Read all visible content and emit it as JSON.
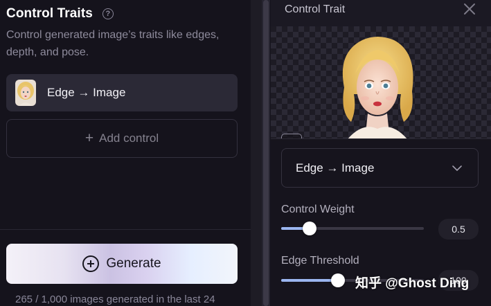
{
  "left_panel": {
    "title": "Control Traits",
    "help_icon": "?",
    "description": "Control generated image’s traits like edges, depth, and pose.",
    "controls": [
      {
        "label": "Edge → Image"
      }
    ],
    "add_control_label": "Add control",
    "add_control_icon": "+",
    "generate_label": "Generate",
    "usage_text": "265 / 1,000 images generated in the last 24"
  },
  "right_panel": {
    "title": "Control Trait",
    "selected_type": "Edge → Image",
    "control_weight": {
      "label": "Control Weight",
      "value": "0.5",
      "fraction": 0.2
    },
    "edge_threshold": {
      "label": "Edge Threshold",
      "value": "100",
      "fraction": 0.4
    }
  },
  "watermark": "知乎 @Ghost Ding",
  "colors": {
    "background": "#15131c",
    "card": "#2b2936",
    "slider_fill": "#9bb6f0",
    "text_muted": "#8e8b9c"
  },
  "icons": [
    "help-icon",
    "plus-icon",
    "plus-circle-icon",
    "close-icon",
    "crop-icon",
    "chevron-down-icon"
  ]
}
